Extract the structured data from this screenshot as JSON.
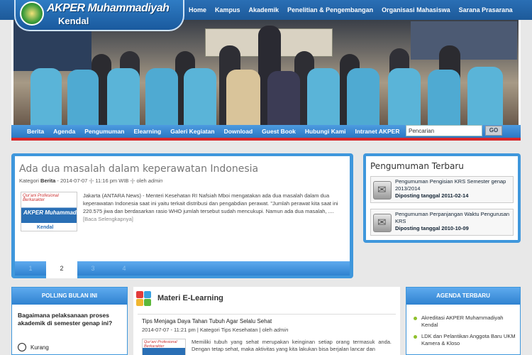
{
  "site": {
    "name": "AKPER Muhammadiyah",
    "city": "Kendal"
  },
  "top_nav": [
    "Home",
    "Kampus",
    "Akademik",
    "Penelitian & Pengembangan",
    "Organisasi Mahasiswa",
    "Sarana Prasarana"
  ],
  "main_nav": [
    "Berita",
    "Agenda",
    "Pengumuman",
    "Elearning",
    "Galeri Kegiatan",
    "Download",
    "Guest Book",
    "Hubungi Kami",
    "Intranet AKPER"
  ],
  "search": {
    "value": "Pencarian",
    "button": "GO"
  },
  "article": {
    "title": "Ada dua masalah dalam keperawatan Indonesia",
    "meta_prefix": "Kategori ",
    "meta_category": "Berita",
    "meta_suffix": " - 2014-07-07 -|- 11:16 pm WIB -|- oleh ",
    "meta_author": "admin",
    "thumb_tagline": "Qur'ani Profesional Berkarakter",
    "thumb_title": "AKPER Muhammadiyah",
    "thumb_city": "Kendal",
    "body": "Jakarta (ANTARA News) - Menteri Kesehatan RI Nafsiah Mboi mengatakan ada dua masalah dalam dua keperawatan Indonesia saat ini yaitu terkait distribusi dan pengabdian perawat. \"Jumlah perawat kita saat ini 220.575 jiwa dan berdasarkan rasio WHO jumlah tersebut sudah mencukupi. Namun ada dua masalah, ....",
    "read_more": "[Baca Selengkapnya]"
  },
  "pager": [
    "1",
    "2",
    "3",
    "4"
  ],
  "pager_active": 1,
  "announcements": {
    "title": "Pengumuman Terbaru",
    "items": [
      {
        "title": "Pengumuman Pengisian KRS Semester genap 2013/2014",
        "date": "Diposting tanggal 2011-02-14"
      },
      {
        "title": "Pengumuman Perpanjangan Waktu Pengurusan KRS",
        "date": "Diposting tanggal 2010-10-09"
      }
    ]
  },
  "poll": {
    "title": "POLLING BULAN INI",
    "question": "Bagaimana pelaksanaan proses akademik di semester genap ini?",
    "option": "Kurang"
  },
  "elearning": {
    "title": "Materi E-Learning",
    "post_title": "Tips Menjaga Daya Tahan Tubuh Agar Selalu Sehat",
    "meta_prefix": "2014-07-07 - 11:21 pm | Kategori Tips Kesehatan | oleh ",
    "meta_author": "admin",
    "thumb_tagline": "Qur'ani Profesional Berkarakter",
    "body": "Memiliki tubuh yang sehat merupakan keinginan setiap orang termasuk anda. Dengan tetap sehat, maka aktivitas yang kita lakukan bisa berjalan lancar dan"
  },
  "agenda": {
    "title": "AGENDA TERBARU",
    "items": [
      "Akreditasi AKPER Muhammadiyah Kendal",
      "LDK dan Pelantikan Anggota Baru UKM Kamera & Kloso"
    ]
  },
  "colors": {
    "brand_blue": "#2a6fb5",
    "accent_red": "#d7262a",
    "bullet_green": "#8fc02c"
  }
}
